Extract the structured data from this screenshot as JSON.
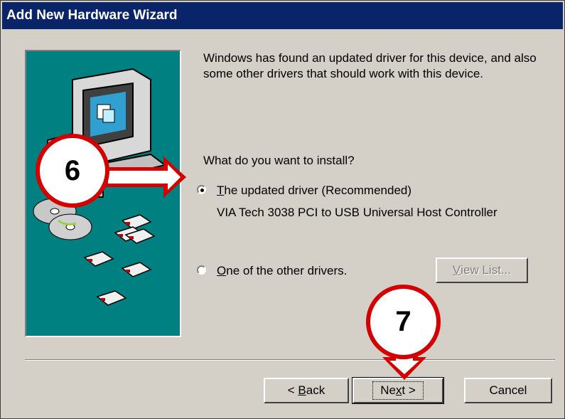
{
  "window": {
    "title": "Add New Hardware Wizard"
  },
  "content": {
    "intro": "Windows has found an updated driver for this device, and also some other drivers that should work with this device.",
    "question": "What do you want to install?",
    "option_updated": {
      "accel": "T",
      "rest": "he updated driver (Recommended)",
      "selected": true
    },
    "device_name": "VIA Tech 3038 PCI to USB Universal Host Controller",
    "option_other": {
      "accel": "O",
      "rest": "ne of the other drivers.",
      "selected": false
    },
    "view_list": {
      "accel": "V",
      "rest": "iew List...",
      "enabled": false
    }
  },
  "buttons": {
    "back": {
      "prefix": "< ",
      "accel": "B",
      "rest": "ack"
    },
    "next": {
      "pre": "Ne",
      "accel": "x",
      "rest": "t >"
    },
    "cancel": "Cancel"
  },
  "annotations": [
    {
      "label": "6",
      "color": "#d40000"
    },
    {
      "label": "7",
      "color": "#d40000"
    }
  ],
  "icons": [
    "computer-monitor-icon",
    "cd-disc-icon",
    "floppy-disk-icon"
  ]
}
